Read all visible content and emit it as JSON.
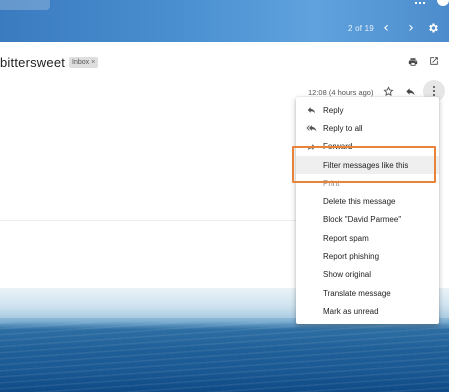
{
  "header": {
    "pager_text": "2 of 19",
    "prev_glyph": "‹",
    "next_glyph": "›",
    "icons": [
      "apps-grid-icon",
      "avatar",
      "gear-icon"
    ]
  },
  "message": {
    "subject": "bittersweet",
    "label": "Inbox",
    "label_remove": "×",
    "timestamp": "12:08 (4 hours ago)",
    "icons": [
      "print-icon",
      "open-new-window-icon",
      "star-icon",
      "reply-icon",
      "more-vert-icon"
    ]
  },
  "menu": {
    "items": [
      {
        "label": "Reply",
        "icon": "reply-icon"
      },
      {
        "label": "Reply to all",
        "icon": "reply-all-icon"
      },
      {
        "label": "Forward",
        "icon": "forward-icon"
      },
      {
        "label": "Filter messages like this",
        "icon": ""
      },
      {
        "label": "Print",
        "icon": ""
      },
      {
        "label": "Delete this message",
        "icon": ""
      },
      {
        "label": "Block \"David Parmee\"",
        "icon": ""
      },
      {
        "label": "Report spam",
        "icon": ""
      },
      {
        "label": "Report phishing",
        "icon": ""
      },
      {
        "label": "Show original",
        "icon": ""
      },
      {
        "label": "Translate message",
        "icon": ""
      },
      {
        "label": "Mark as unread",
        "icon": ""
      }
    ],
    "highlighted_index": 3
  },
  "colors": {
    "topbar": "#4a8fd0",
    "highlight_outline": "#e8843a",
    "menu_hover": "#efefef",
    "ocean": "#1f5f98"
  }
}
